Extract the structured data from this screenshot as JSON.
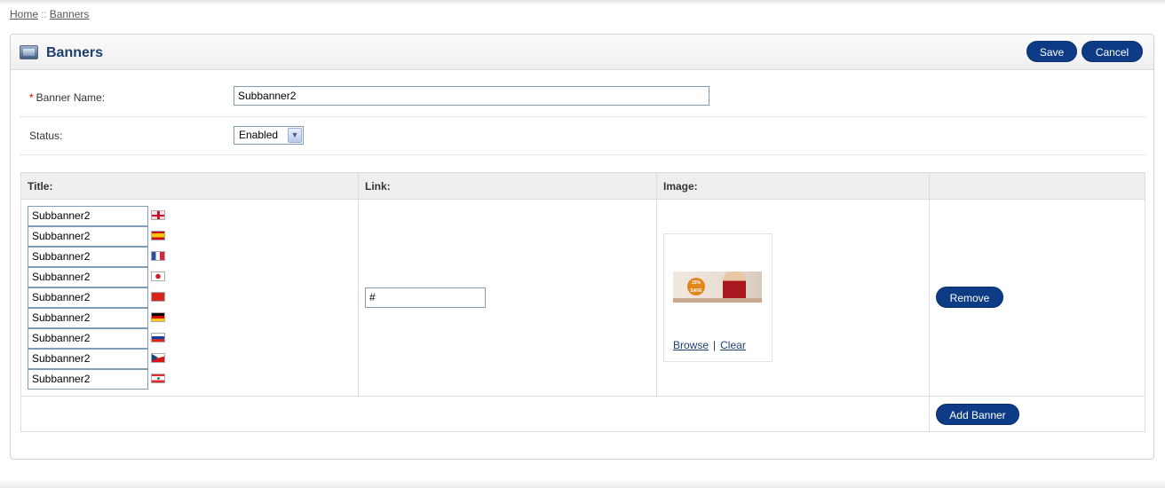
{
  "breadcrumb": {
    "home": "Home",
    "separator": "::",
    "current": "Banners"
  },
  "header": {
    "title": "Banners",
    "save_label": "Save",
    "cancel_label": "Cancel"
  },
  "form": {
    "required_mark": "*",
    "banner_name_label": "Banner Name:",
    "banner_name_value": "Subbanner2",
    "status_label": "Status:",
    "status_value": "Enabled"
  },
  "table": {
    "headers": [
      "Title:",
      "Link:",
      "Image:",
      ""
    ],
    "titles": [
      {
        "value": "Subbanner2",
        "flag": "uk-flag-icon"
      },
      {
        "value": "Subbanner2",
        "flag": "spain-flag-icon"
      },
      {
        "value": "Subbanner2",
        "flag": "france-flag-icon"
      },
      {
        "value": "Subbanner2",
        "flag": "japan-flag-icon"
      },
      {
        "value": "Subbanner2",
        "flag": "china-flag-icon"
      },
      {
        "value": "Subbanner2",
        "flag": "germany-flag-icon"
      },
      {
        "value": "Subbanner2",
        "flag": "russia-flag-icon"
      },
      {
        "value": "Subbanner2",
        "flag": "czech-flag-icon"
      },
      {
        "value": "Subbanner2",
        "flag": "lebanon-flag-icon"
      }
    ],
    "link_value": "#",
    "image": {
      "badge_text": "25% SAVE",
      "browse_label": "Browse",
      "separator": "|",
      "clear_label": "Clear"
    },
    "remove_label": "Remove",
    "add_banner_label": "Add Banner"
  },
  "colors": {
    "button_bg": "#0d3b85",
    "heading": "#1d3f6e",
    "input_border": "#7f9db9"
  }
}
